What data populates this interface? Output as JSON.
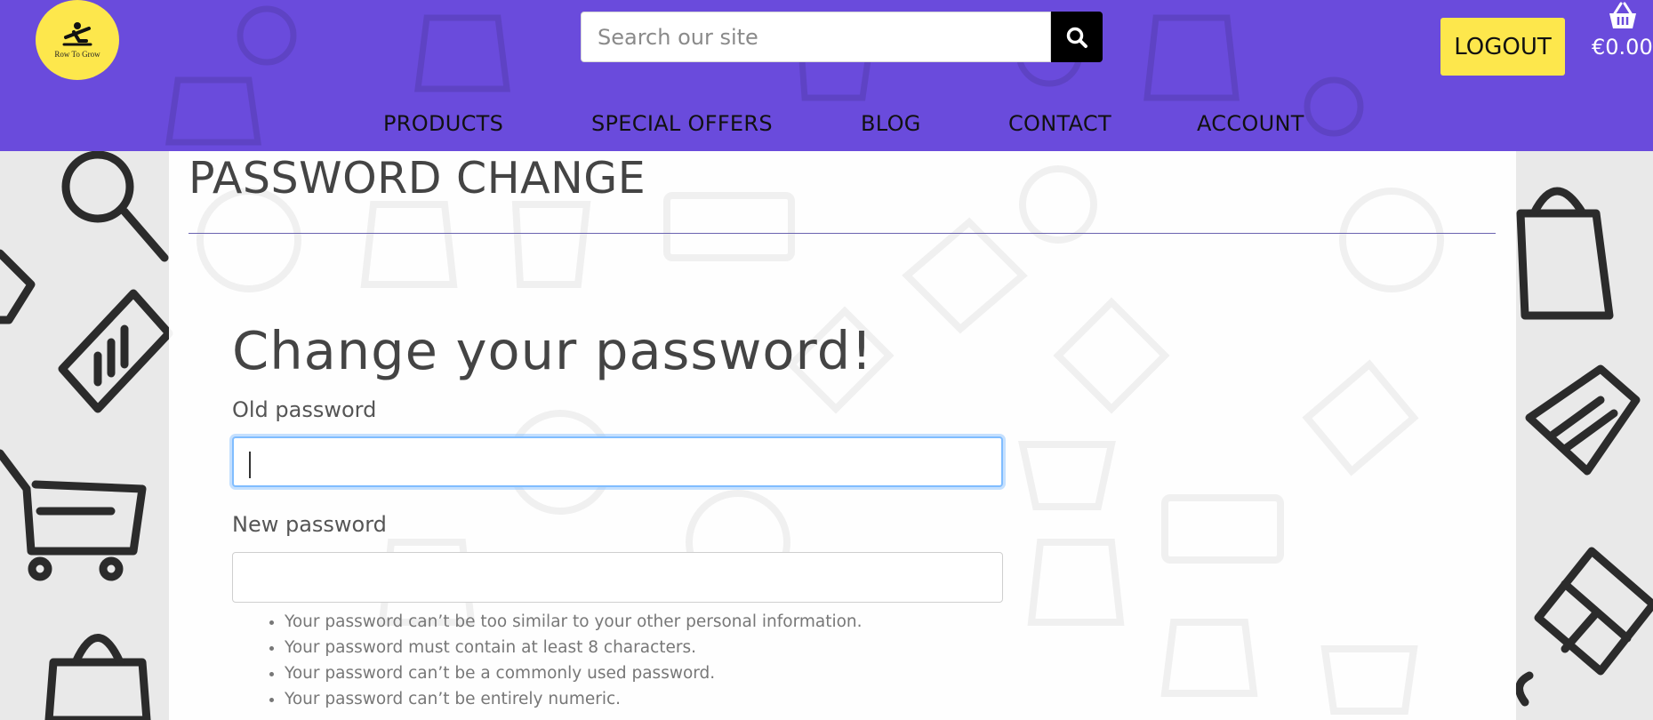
{
  "header": {
    "logo": {
      "text": "Row To Grow"
    },
    "search": {
      "placeholder": "Search our site",
      "value": ""
    },
    "logout_label": "LOGOUT",
    "basket_total": "€0.00",
    "nav": [
      {
        "label": "PRODUCTS"
      },
      {
        "label": "SPECIAL OFFERS"
      },
      {
        "label": "BLOG"
      },
      {
        "label": "CONTACT"
      },
      {
        "label": "ACCOUNT"
      }
    ]
  },
  "main": {
    "page_title": "PASSWORD CHANGE",
    "form_heading": "Change your password!",
    "old_password": {
      "label": "Old password",
      "value": ""
    },
    "new_password": {
      "label": "New password",
      "value": ""
    },
    "help_text": [
      "Your password can’t be too similar to your other personal information.",
      "Your password must contain at least 8 characters.",
      "Your password can’t be a commonly used password.",
      "Your password can’t be entirely numeric."
    ]
  },
  "colors": {
    "header_bg": "#6a4bdc",
    "accent_yellow": "#fde74c",
    "search_button_bg": "#000000",
    "focus_ring": "#80bdff"
  }
}
